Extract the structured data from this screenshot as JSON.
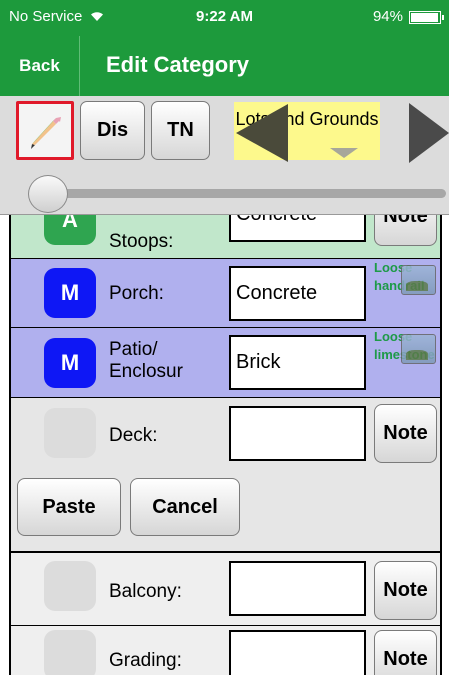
{
  "status_bar": {
    "carrier": "No Service",
    "wifi_icon": "wifi-icon",
    "time": "9:22 AM",
    "battery": "94%"
  },
  "nav": {
    "back": "Back",
    "title": "Edit Category"
  },
  "toolbar": {
    "edit_icon": "pencil-icon",
    "dis": "Dis",
    "tn": "TN",
    "category": "Lots and Grounds",
    "prev_icon": "arrow-left-icon",
    "next_icon": "arrow-right-icon"
  },
  "slider": {
    "level": 0.0
  },
  "rows": [
    {
      "badge": "A",
      "label": "Stoops:",
      "value": "Concrete",
      "note": "Note"
    },
    {
      "badge": "M",
      "label": "Porch:",
      "value": "Concrete",
      "note_text": "Loose handrail"
    },
    {
      "badge": "M",
      "label": "Patio/ Enclosur",
      "value": "Brick",
      "note_text": "Loose limestone"
    },
    {
      "badge": "",
      "label": "Deck:",
      "value": "",
      "note": "Note"
    },
    {
      "badge": "",
      "label": "Balcony:",
      "value": "",
      "note": "Note"
    },
    {
      "badge": "",
      "label": "Grading:",
      "value": "",
      "note": "Note"
    }
  ],
  "actions": {
    "paste": "Paste",
    "cancel": "Cancel"
  },
  "colors": {
    "header_green": "#1d9a3c",
    "highlight_red": "#e0192a",
    "maintenance_blue": "#0e17f5",
    "row_purple": "#b0b0ee",
    "row_green": "#c1e7cb",
    "note_green": "#1e9a48",
    "category_yellow": "#fdf98c"
  }
}
